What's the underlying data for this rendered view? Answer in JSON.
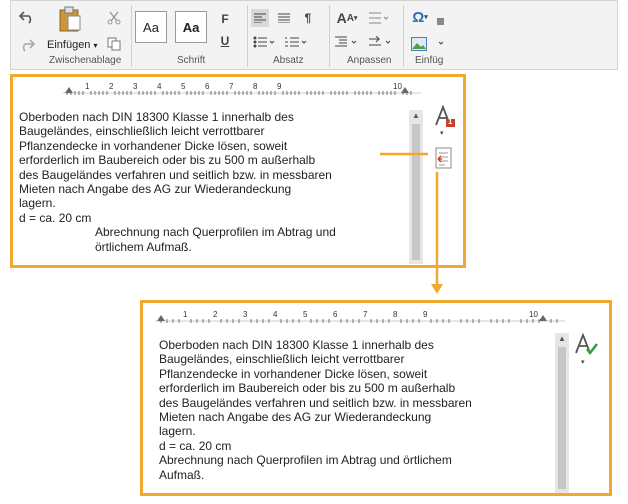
{
  "ribbon": {
    "paste_label": "Einfügen",
    "paste_arrow": "▾",
    "style_a": "Aa",
    "style_b": "Aa",
    "font_f": "F",
    "font_u": "U",
    "pilcrow": "¶",
    "omega": "Ω",
    "groups": {
      "clipboard": "Zwischenablage",
      "font": "Schrift",
      "paragraph": "Absatz",
      "adjust": "Anpassen",
      "insert": "Einfüg"
    }
  },
  "top_panel": {
    "ruler_numbers": [
      "1",
      "2",
      "3",
      "4",
      "5",
      "6",
      "7",
      "8",
      "9",
      "10"
    ],
    "lines": [
      "Oberboden nach DIN 18300 Klasse 1 innerhalb des",
      "Baugeländes, einschließlich leicht verrottbarer",
      "Pflanzendecke in vorhandener Dicke lösen, soweit",
      "erforderlich im Baubereich oder bis zu 500 m außerhalb",
      "des Baugeländes verfahren und seitlich bzw. in messbaren",
      "Mieten nach Angabe des AG zur Wiederandeckung",
      "lagern.",
      "d = ca. 20 cm"
    ],
    "indented_lines": [
      "Abrechnung nach Querprofilen im Abtrag und",
      "örtlichem Aufmaß."
    ],
    "spell_badge": "1"
  },
  "bottom_panel": {
    "ruler_numbers": [
      "1",
      "2",
      "3",
      "4",
      "5",
      "6",
      "7",
      "8",
      "9",
      "10"
    ],
    "lines": [
      "Oberboden nach DIN 18300 Klasse 1 innerhalb des",
      "Baugeländes, einschließlich leicht verrottbarer",
      "Pflanzendecke in vorhandener Dicke lösen, soweit",
      "erforderlich im Baubereich oder bis zu 500 m außerhalb",
      "des Baugeländes verfahren und seitlich bzw. in messbaren",
      "Mieten nach Angabe des AG zur Wiederandeckung",
      "lagern.",
      "d = ca. 20 cm",
      "Abrechnung nach Querprofilen im Abtrag und örtlichem",
      "Aufmaß."
    ]
  },
  "colors": {
    "highlight": "#f0a830",
    "spell_badge": "#c8402a",
    "check": "#3a9a3a"
  }
}
